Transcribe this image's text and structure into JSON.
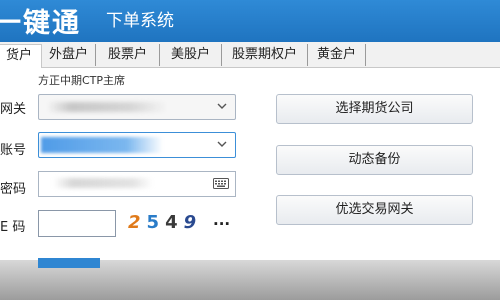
{
  "app": {
    "title": "一键通",
    "subtitle": "下单系统"
  },
  "tabs": [
    {
      "label": "货户",
      "active": true
    },
    {
      "label": "外盘户"
    },
    {
      "label": "股票户"
    },
    {
      "label": "美股户"
    },
    {
      "label": "股票期权户"
    },
    {
      "label": "黄金户"
    }
  ],
  "form": {
    "broker_label": "方正中期CTP主席",
    "gateway_label": "网关",
    "account_label": "账号",
    "password_label": "密码",
    "captcha_label": "E 码",
    "captcha_digits": [
      "2",
      "5",
      "4",
      "9"
    ],
    "captcha_refresh": "...",
    "gateway_value": "",
    "account_value": "",
    "password_value": "",
    "captcha_value": ""
  },
  "side_buttons": {
    "select_broker": "选择期货公司",
    "dynamic_backup": "动态备份",
    "preferred_gateway": "优选交易网关"
  },
  "icons": {
    "dropdown": "chevron-down-icon",
    "keyboard": "keyboard-icon"
  },
  "colors": {
    "titlebar": "#1f74c0",
    "accent": "#2f86d2"
  }
}
